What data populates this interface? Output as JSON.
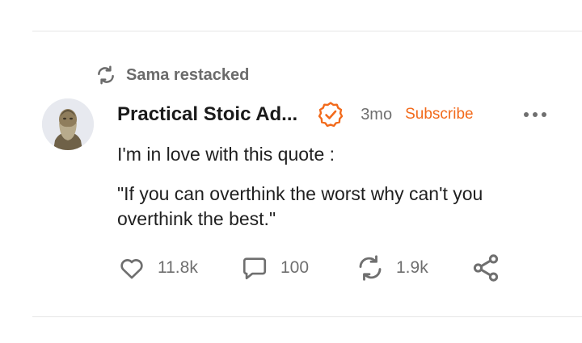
{
  "restack": {
    "text": "Sama restacked",
    "icon": "restack-icon"
  },
  "post": {
    "author": "Practical Stoic Ad...",
    "verified_icon": "verified-check-icon",
    "time": "3mo",
    "subscribe_label": "Subscribe",
    "more_icon": "more-options-icon",
    "body_line1": "I'm in love with this quote :",
    "body_quote": "\"If you can overthink the worst why can't you overthink the best.\""
  },
  "actions": {
    "likes": "11.8k",
    "comments": "100",
    "restacks": "1.9k",
    "share_icon": "share-icon"
  },
  "colors": {
    "accent": "#f26a1b",
    "muted": "#6f6f6f",
    "text": "#1f1f1f",
    "divider": "#e6e6e6"
  }
}
